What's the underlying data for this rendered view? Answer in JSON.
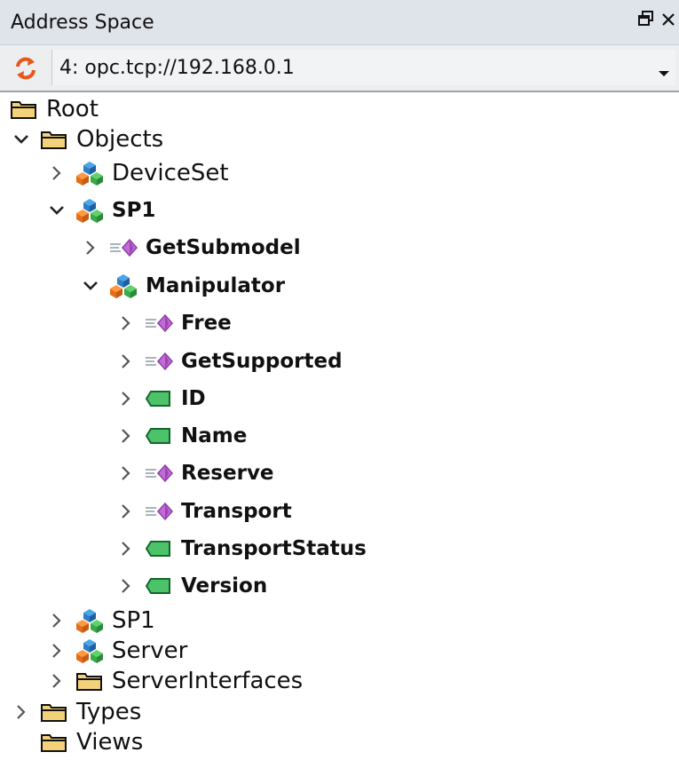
{
  "panel": {
    "title": "Address Space",
    "restore_icon": "restore-window-icon",
    "close_icon": "close-icon"
  },
  "address": {
    "value": "4: opc.tcp://192.168.0.1",
    "refresh_icon": "refresh-icon",
    "dropdown_icon": "dropdown-arrow-icon"
  },
  "tree": [
    {
      "label": "Root",
      "icon": "folder-icon",
      "bold": false
    },
    {
      "label": "Objects",
      "icon": "folder-icon",
      "bold": false,
      "expanded": true
    },
    {
      "label": "DeviceSet",
      "icon": "object-icon",
      "bold": false,
      "expanded": false
    },
    {
      "label": "SP1",
      "icon": "object-icon",
      "bold": true,
      "expanded": true
    },
    {
      "label": "GetSubmodel",
      "icon": "method-icon",
      "bold": true,
      "expanded": false
    },
    {
      "label": "Manipulator",
      "icon": "object-icon",
      "bold": true,
      "expanded": true
    },
    {
      "label": "Free",
      "icon": "method-icon",
      "bold": true,
      "expanded": false
    },
    {
      "label": "GetSupported",
      "icon": "method-icon",
      "bold": true,
      "expanded": false
    },
    {
      "label": "ID",
      "icon": "variable-icon",
      "bold": true,
      "expanded": false
    },
    {
      "label": "Name",
      "icon": "variable-icon",
      "bold": true,
      "expanded": false
    },
    {
      "label": "Reserve",
      "icon": "method-icon",
      "bold": true,
      "expanded": false
    },
    {
      "label": "Transport",
      "icon": "method-icon",
      "bold": true,
      "expanded": false
    },
    {
      "label": "TransportStatus",
      "icon": "variable-icon",
      "bold": true,
      "expanded": false
    },
    {
      "label": "Version",
      "icon": "variable-icon",
      "bold": true,
      "expanded": false
    },
    {
      "label": "SP1",
      "icon": "object-icon",
      "bold": false,
      "expanded": false
    },
    {
      "label": "Server",
      "icon": "object-icon",
      "bold": false,
      "expanded": false
    },
    {
      "label": "ServerInterfaces",
      "icon": "folder-icon",
      "bold": false,
      "expanded": false
    },
    {
      "label": "Types",
      "icon": "folder-icon",
      "bold": false,
      "expanded": false
    },
    {
      "label": "Views",
      "icon": "folder-icon",
      "bold": false
    }
  ]
}
